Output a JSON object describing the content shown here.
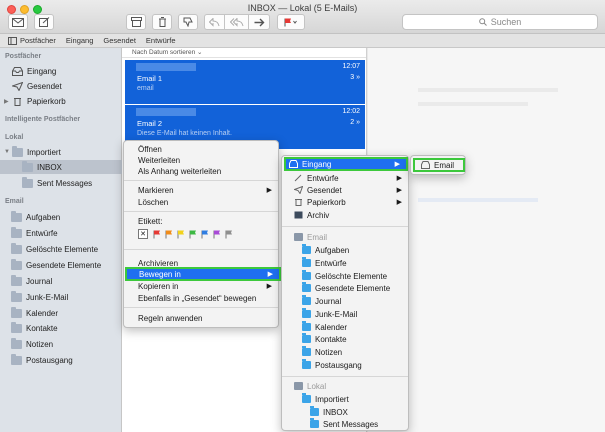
{
  "window": {
    "title": "INBOX — Lokal (5 E-Mails)"
  },
  "toolbar": {
    "search_placeholder": "Suchen"
  },
  "favorites": [
    "Postfächer",
    "Eingang",
    "Gesendet",
    "Entwürfe"
  ],
  "sidebar": {
    "postfaecher_header": "Postfächer",
    "inbox": "Eingang",
    "sent": "Gesendet",
    "trash": "Papierkorb",
    "smart_header": "Intelligente Postfächer",
    "local_header": "Lokal",
    "imported": "Importiert",
    "inbox_local": "INBOX",
    "sent_messages": "Sent Messages",
    "email_header": "Email",
    "email_folders": [
      "Aufgaben",
      "Entwürfe",
      "Gelöschte Elemente",
      "Gesendete Elemente",
      "Journal",
      "Junk-E-Mail",
      "Kalender",
      "Kontakte",
      "Notizen",
      "Postausgang"
    ]
  },
  "list": {
    "sort_label": "Nach Datum sortieren",
    "messages": [
      {
        "time": "12:07",
        "subject": "Email 1",
        "count": "3",
        "preview": "email"
      },
      {
        "time": "12:02",
        "subject": "Email 2",
        "count": "2",
        "preview": "Diese E-Mail hat keinen Inhalt."
      }
    ]
  },
  "context_menu": {
    "open": "Öffnen",
    "forward": "Weiterleiten",
    "forward_attachment": "Als Anhang weiterleiten",
    "mark": "Markieren",
    "delete": "Löschen",
    "label": "Etikett:",
    "archive": "Archivieren",
    "move_to": "Bewegen in",
    "copy_to": "Kopieren in",
    "also_in_sent": "Ebenfalls in „Gesendet“ bewegen",
    "apply_rules": "Regeln anwenden",
    "flag_colors": [
      "#e53935",
      "#f08c1a",
      "#f2d21b",
      "#3db843",
      "#2f7de1",
      "#a84ad6",
      "#8f8f8f"
    ]
  },
  "move_menu": {
    "inbox": "Eingang",
    "drafts": "Entwürfe",
    "sent": "Gesendet",
    "trash": "Papierkorb",
    "archive": "Archiv",
    "email_header": "Email",
    "email_folders": [
      "Aufgaben",
      "Entwürfe",
      "Gelöschte Elemente",
      "Gesendete Elemente",
      "Journal",
      "Junk-E-Mail",
      "Kalender",
      "Kontakte",
      "Notizen",
      "Postausgang"
    ],
    "local_header": "Lokal",
    "imported": "Importiert",
    "inbox_local": "INBOX",
    "sent_messages": "Sent Messages"
  },
  "inbox_submenu": {
    "email": "Email"
  }
}
